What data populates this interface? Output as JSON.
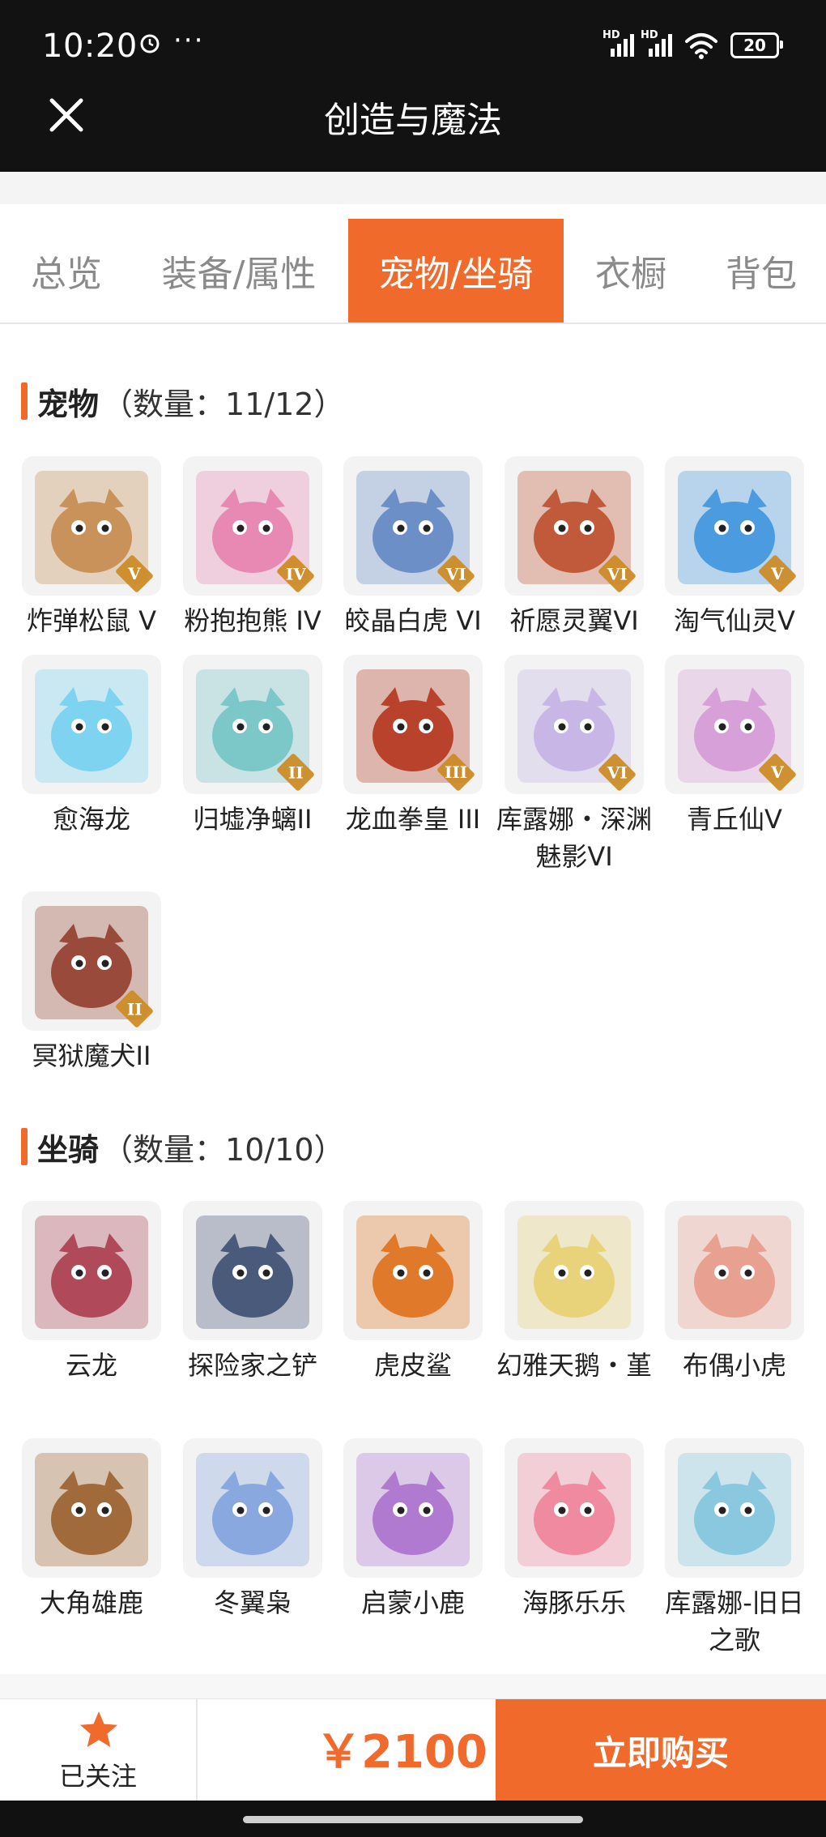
{
  "status": {
    "time": "10:20",
    "more": "···",
    "battery": "20",
    "hd1": "HD",
    "hd2": "HD"
  },
  "header": {
    "title": "创造与魔法"
  },
  "tabs": [
    {
      "label": "总览"
    },
    {
      "label": "装备/属性"
    },
    {
      "label": "宠物/坐骑"
    },
    {
      "label": "衣橱"
    },
    {
      "label": "背包"
    }
  ],
  "pets": {
    "title": "宠物",
    "count": "（数量：11/12）",
    "items": [
      {
        "label": "炸弹松鼠 V",
        "badge": "V",
        "color": "#c9925a"
      },
      {
        "label": "粉抱抱熊 IV",
        "badge": "IV",
        "color": "#e889b4"
      },
      {
        "label": "皎晶白虎 VI",
        "badge": "VI",
        "color": "#6c8fc7"
      },
      {
        "label": "祈愿灵翼VI",
        "badge": "VI",
        "color": "#c05a3a"
      },
      {
        "label": "淘气仙灵V",
        "badge": "V",
        "color": "#4a9be0"
      },
      {
        "label": "愈海龙",
        "badge": "",
        "color": "#7dd3f0"
      },
      {
        "label": "归墟净螭II",
        "badge": "II",
        "color": "#7cc7c8"
      },
      {
        "label": "龙血拳皇 III",
        "badge": "III",
        "color": "#b8422c"
      },
      {
        "label": "库露娜・深渊魅影VI",
        "badge": "VI",
        "color": "#c7b6e6"
      },
      {
        "label": "青丘仙V",
        "badge": "V",
        "color": "#d8a0d8"
      },
      {
        "label": "冥狱魔犬II",
        "badge": "II",
        "color": "#9a4a3a"
      }
    ]
  },
  "mounts": {
    "title": "坐骑",
    "count": "（数量：10/10）",
    "items": [
      {
        "label": "云龙",
        "color": "#b04a5a"
      },
      {
        "label": "探险家之铲",
        "color": "#4a5a7a"
      },
      {
        "label": "虎皮鲨",
        "color": "#e07a2a"
      },
      {
        "label": "幻雅天鹅・堇",
        "color": "#e8d27a"
      },
      {
        "label": "布偶小虎",
        "color": "#e8a090"
      },
      {
        "label": "大角雄鹿",
        "color": "#a06a3a"
      },
      {
        "label": "冬翼枭",
        "color": "#8aa8e0"
      },
      {
        "label": "启蒙小鹿",
        "color": "#b07ad0"
      },
      {
        "label": "海豚乐乐",
        "color": "#f08aa0"
      },
      {
        "label": "库露娜-旧日之歌",
        "color": "#8ac8e0"
      }
    ]
  },
  "footer": {
    "follow_label": "已关注",
    "price": "￥2100",
    "buy_label": "立即购买"
  },
  "colors": {
    "accent": "#f06a2c",
    "topbar": "#121212"
  }
}
